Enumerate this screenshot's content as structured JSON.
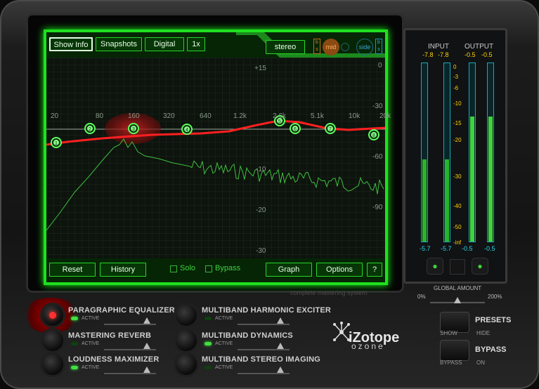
{
  "screen": {
    "top_buttons": [
      "Show Info",
      "Snapshots",
      "Digital",
      "1x"
    ],
    "mode_button": "stereo",
    "ms_labels": {
      "b1": "b",
      "s1": "s",
      "mid": "mid",
      "side": "side",
      "b2": "b",
      "s2": "s"
    },
    "freq_ticks": [
      "20",
      "80",
      "160",
      "320",
      "640",
      "1.2k",
      "2.6k",
      "5.1k",
      "10k",
      "20k"
    ],
    "db_ticks_center": [
      "+15",
      "-10",
      "-20",
      "-30"
    ],
    "db_ticks_right": [
      "0",
      "-30",
      "-60",
      "-90"
    ],
    "band_nodes": [
      "1",
      "2",
      "3",
      "4",
      "5",
      "6",
      "7",
      "8"
    ],
    "bottom_buttons": {
      "reset": "Reset",
      "history": "History",
      "solo": "Solo",
      "bypass": "Bypass",
      "graph": "Graph",
      "options": "Options",
      "help": "?"
    },
    "tagline": "complete mastering system"
  },
  "meters": {
    "input_label": "INPUT",
    "output_label": "OUTPUT",
    "input_peak": [
      "-7.8",
      "-7.8"
    ],
    "output_peak": [
      "-0.5",
      "-0.5"
    ],
    "scale": [
      "0",
      "-3",
      "-6",
      "-10",
      "-15",
      "-20",
      "-30",
      "-40",
      "-50",
      "-inf"
    ],
    "input_rms": [
      "-5.7",
      "-5.7"
    ],
    "output_rms": [
      "-0.5",
      "-0.5"
    ],
    "global_amount_label": "GLOBAL AMOUNT",
    "global_min": "0%",
    "global_max": "200%",
    "input_level": 0.46,
    "output_level": 0.7
  },
  "modules": [
    {
      "label": "PARAGRAPHIC EQUALIZER",
      "active_label": "ACTIVE",
      "active": true,
      "selected": true
    },
    {
      "label": "MASTERING REVERB",
      "active_label": "ACTIVE",
      "active": false,
      "selected": false
    },
    {
      "label": "LOUDNESS MAXIMIZER",
      "active_label": "ACTIVE",
      "active": true,
      "selected": false
    },
    {
      "label": "MULTIBAND HARMONIC EXCITER",
      "active_label": "ACTIVE",
      "active": false,
      "selected": false
    },
    {
      "label": "MULTIBAND DYNAMICS",
      "active_label": "ACTIVE",
      "active": true,
      "selected": false
    },
    {
      "label": "MULTIBAND STEREO IMAGING",
      "active_label": "ACTIVE",
      "active": false,
      "selected": false
    }
  ],
  "brand": {
    "name": "iZotope",
    "product": "ozone"
  },
  "presets": {
    "label": "PRESETS",
    "show": "SHOW",
    "hide": "HIDE"
  },
  "bypass": {
    "label": "BYPASS",
    "bypass": "BYPASS",
    "on": "ON"
  },
  "colors": {
    "screen_green": "#1fe01f",
    "eq_curve": "#ff2020",
    "spectrum": "#3fbf3f",
    "meter_cyan": "#29d6e6",
    "meter_green": "#3fd23f"
  }
}
